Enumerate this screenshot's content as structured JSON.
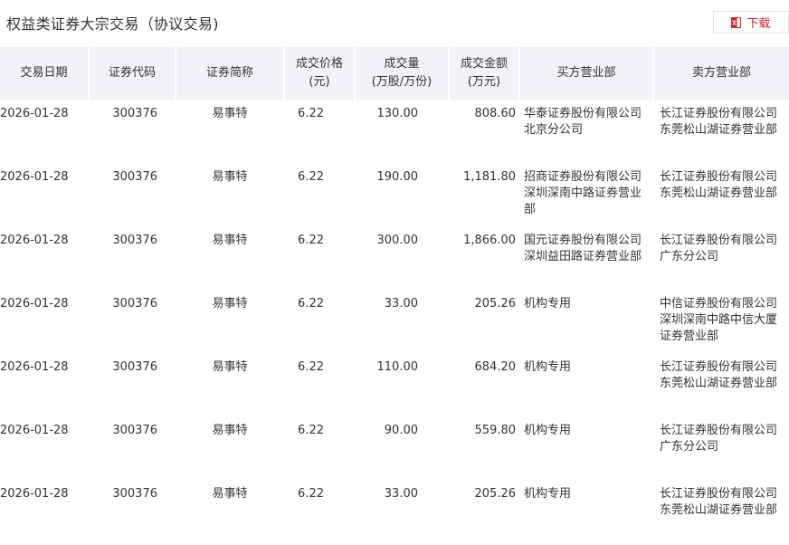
{
  "header": {
    "title": "权益类证券大宗交易（协议交易)",
    "download_label": "下载",
    "accent_color": "#d8232a"
  },
  "table": {
    "columns": [
      "交易日期",
      "证券代码",
      "证券简称",
      "成交价格\n(元)",
      "成交量\n(万股/万份)",
      "成交金额\n(万元)",
      "买方营业部",
      "卖方营业部"
    ],
    "rows": [
      {
        "date": "2026-01-28",
        "code": "300376",
        "name": "易事特",
        "price": "6.22",
        "volume": "130.00",
        "amount": "808.60",
        "buyer": "华泰证券股份有限公司北京分公司",
        "seller": "长江证券股份有限公司东莞松山湖证券营业部"
      },
      {
        "date": "2026-01-28",
        "code": "300376",
        "name": "易事特",
        "price": "6.22",
        "volume": "190.00",
        "amount": "1,181.80",
        "buyer": "招商证券股份有限公司深圳深南中路证券营业部",
        "seller": "长江证券股份有限公司东莞松山湖证券营业部"
      },
      {
        "date": "2026-01-28",
        "code": "300376",
        "name": "易事特",
        "price": "6.22",
        "volume": "300.00",
        "amount": "1,866.00",
        "buyer": "国元证券股份有限公司深圳益田路证券营业部",
        "seller": "长江证券股份有限公司广东分公司"
      },
      {
        "date": "2026-01-28",
        "code": "300376",
        "name": "易事特",
        "price": "6.22",
        "volume": "33.00",
        "amount": "205.26",
        "buyer": "机构专用",
        "seller": "中信证券股份有限公司深圳深南中路中信大厦证券营业部"
      },
      {
        "date": "2026-01-28",
        "code": "300376",
        "name": "易事特",
        "price": "6.22",
        "volume": "110.00",
        "amount": "684.20",
        "buyer": "机构专用",
        "seller": "长江证券股份有限公司东莞松山湖证券营业部"
      },
      {
        "date": "2026-01-28",
        "code": "300376",
        "name": "易事特",
        "price": "6.22",
        "volume": "90.00",
        "amount": "559.80",
        "buyer": "机构专用",
        "seller": "长江证券股份有限公司广东分公司"
      },
      {
        "date": "2026-01-28",
        "code": "300376",
        "name": "易事特",
        "price": "6.22",
        "volume": "33.00",
        "amount": "205.26",
        "buyer": "机构专用",
        "seller": "长江证券股份有限公司东莞松山湖证券营业部"
      }
    ]
  }
}
